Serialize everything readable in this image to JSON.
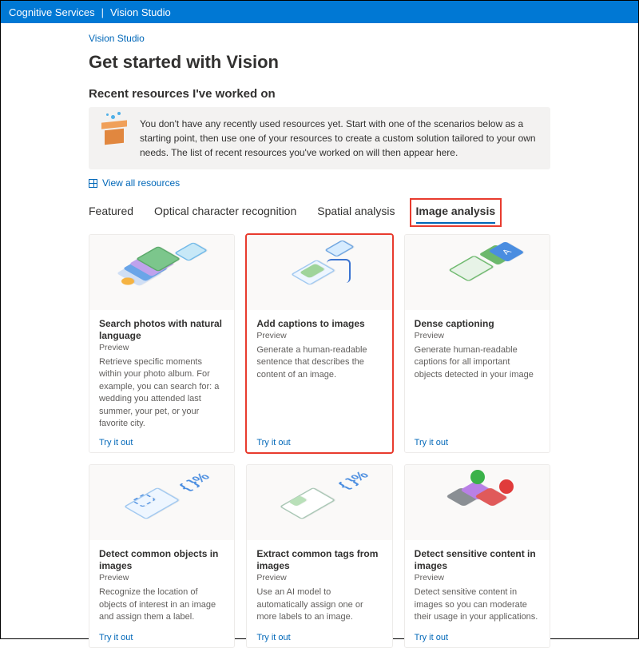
{
  "topbar": {
    "service": "Cognitive Services",
    "studio": "Vision Studio"
  },
  "breadcrumb": "Vision Studio",
  "page_title": "Get started with Vision",
  "recent": {
    "heading": "Recent resources I've worked on",
    "notice": "You don't have any recently used resources yet. Start with one of the scenarios below as a starting point, then use one of your resources to create a custom solution tailored to your own needs. The list of recent resources you've worked on will then appear here.",
    "view_all": "View all resources"
  },
  "tabs": [
    {
      "label": "Featured"
    },
    {
      "label": "Optical character recognition"
    },
    {
      "label": "Spatial analysis"
    },
    {
      "label": "Image analysis",
      "active": true,
      "highlighted": true
    }
  ],
  "try_label": "Try it out",
  "preview_label": "Preview",
  "cards": [
    {
      "title": "Search photos with natural language",
      "desc": "Retrieve specific moments within your photo album. For example, you can search for: a wedding you attended last summer, your pet, or your favorite city."
    },
    {
      "title": "Add captions to images",
      "desc": "Generate a human-readable sentence that describes the content of an image.",
      "highlighted": true
    },
    {
      "title": "Dense captioning",
      "desc": "Generate human-readable captions for all important objects detected in your image"
    },
    {
      "title": "Detect common objects in images",
      "desc": "Recognize the location of objects of interest in an image and assign them a label."
    },
    {
      "title": "Extract common tags from images",
      "desc": "Use an AI model to automatically assign one or more labels to an image."
    },
    {
      "title": "Detect sensitive content in images",
      "desc": "Detect sensitive content in images so you can moderate their usage in your applications."
    }
  ]
}
